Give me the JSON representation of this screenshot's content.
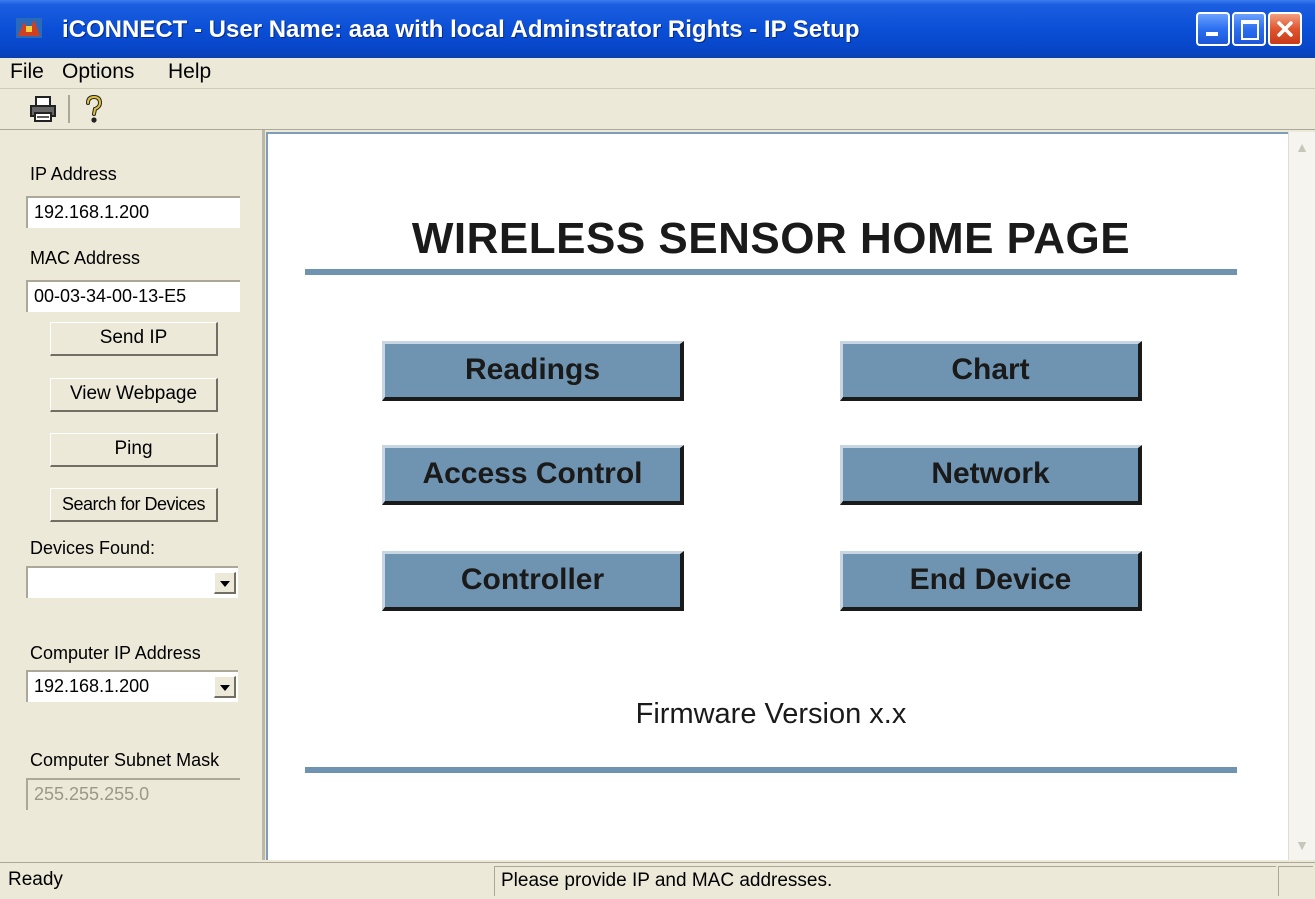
{
  "window": {
    "title": "iCONNECT - User Name: aaa with local Adminstrator Rights - IP Setup",
    "icon": "app-icon"
  },
  "menu": {
    "items": [
      {
        "label": "File"
      },
      {
        "label": "Options"
      },
      {
        "label": "Help"
      }
    ]
  },
  "toolbar": {
    "icons": [
      "printer-icon",
      "help-icon"
    ]
  },
  "left_panel": {
    "ip_address_label": "IP Address",
    "ip_address_value": "192.168.1.200",
    "mac_address_label": "MAC Address",
    "mac_address_value": "00-03-34-00-13-E5",
    "send_ip_label": "Send IP",
    "view_webpage_label": "View Webpage",
    "ping_label": "Ping",
    "search_label": "Search for Devices",
    "devices_found_label": "Devices Found:",
    "devices_found_value": "",
    "computer_ip_label": "Computer IP Address",
    "computer_ip_value": "192.168.1.200",
    "subnet_label": "Computer Subnet Mask",
    "subnet_value": "255.255.255.0"
  },
  "web": {
    "heading": "WIRELESS SENSOR HOME PAGE",
    "buttons": {
      "readings": "Readings",
      "chart": "Chart",
      "access_control": "Access Control",
      "network": "Network",
      "controller": "Controller",
      "end_device": "End Device"
    },
    "firmware": "Firmware Version x.x",
    "accent_color": "#6f94b1"
  },
  "status": {
    "left": "Ready",
    "right": "Please provide IP and MAC addresses."
  }
}
